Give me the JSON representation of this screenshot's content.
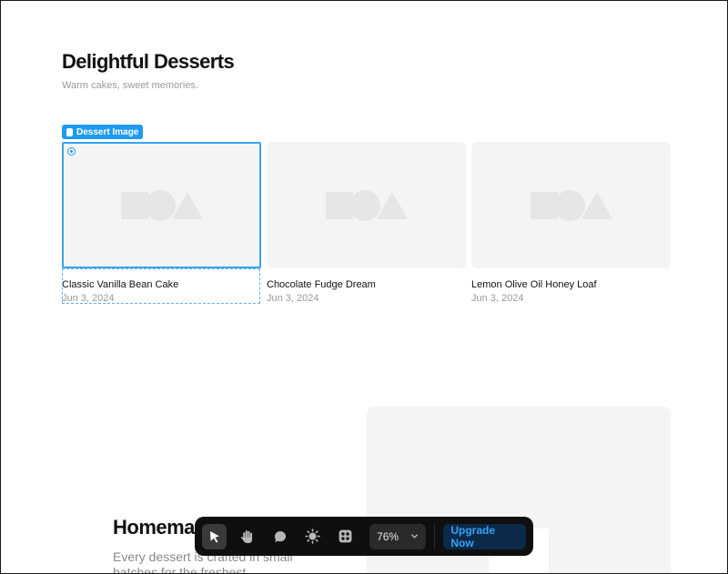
{
  "page": {
    "title": "Delightful Desserts",
    "subtitle": "Warm cakes, sweet memories."
  },
  "selection": {
    "tag_label": "Dessert Image",
    "tag_icon": "database-icon",
    "accent": "#1e9bf0"
  },
  "cards": [
    {
      "title": "Classic Vanilla Bean Cake",
      "date": "Jun 3, 2024"
    },
    {
      "title": "Chocolate Fudge Dream",
      "date": "Jun 3, 2024"
    },
    {
      "title": "Lemon Olive Oil Honey Loaf",
      "date": "Jun 3, 2024"
    }
  ],
  "section": {
    "title": "Homemade",
    "body": "Every dessert is crafted in small batches for the freshest"
  },
  "toolbar": {
    "tools": [
      "select-cursor-icon",
      "hand-pan-icon",
      "comment-bubble-icon",
      "sun-theme-icon",
      "component-grid-icon"
    ],
    "zoom": "76%",
    "upgrade_label": "Upgrade Now"
  }
}
